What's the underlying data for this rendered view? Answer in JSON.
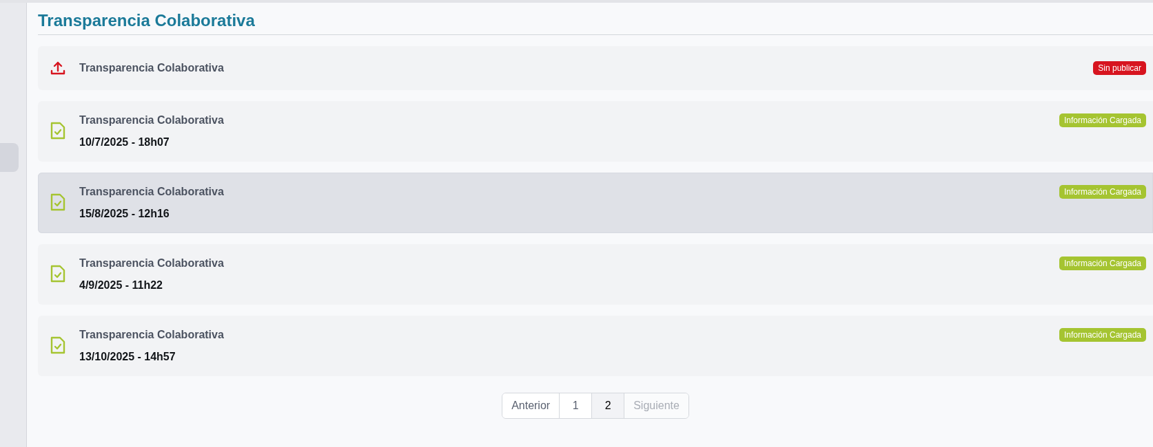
{
  "page_title": "Transparencia Colaborativa",
  "sidebar": {
    "items": [
      {
        "selected": true
      }
    ]
  },
  "entries": [
    {
      "kind": "upload",
      "title": "Transparencia Colaborativa",
      "badge": {
        "label": "Sin publicar",
        "color": "#d7141f"
      },
      "highlighted": false
    },
    {
      "kind": "loaded",
      "title": "Transparencia Colaborativa",
      "date": "10/7/2025 - 18h07",
      "badge": {
        "label": "Información Cargada",
        "color": "#a5c431"
      },
      "highlighted": false
    },
    {
      "kind": "loaded",
      "title": "Transparencia Colaborativa",
      "date": "15/8/2025 - 12h16",
      "badge": {
        "label": "Información Cargada",
        "color": "#a5c431"
      },
      "highlighted": true
    },
    {
      "kind": "loaded",
      "title": "Transparencia Colaborativa",
      "date": "4/9/2025 - 11h22",
      "badge": {
        "label": "Información Cargada",
        "color": "#a5c431"
      },
      "highlighted": false
    },
    {
      "kind": "loaded",
      "title": "Transparencia Colaborativa",
      "date": "13/10/2025 - 14h57",
      "badge": {
        "label": "Información Cargada",
        "color": "#a5c431"
      },
      "highlighted": false
    }
  ],
  "pagination": [
    {
      "label": "Anterior",
      "selected": false,
      "disabled": false
    },
    {
      "label": "1",
      "selected": false,
      "disabled": false
    },
    {
      "label": "2",
      "selected": true,
      "disabled": false
    },
    {
      "label": "Siguiente",
      "selected": false,
      "disabled": true
    }
  ]
}
